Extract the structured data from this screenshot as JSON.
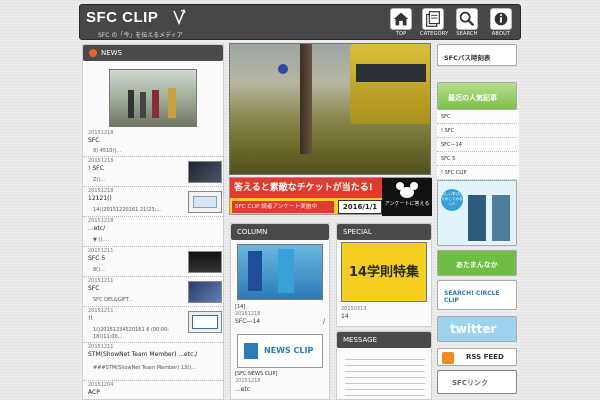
{
  "header": {
    "logo": "SFC CLIP",
    "tagline": "SFC の「今」を伝えるメディア",
    "nav": [
      {
        "label": "TOP",
        "icon": "home-icon"
      },
      {
        "label": "CATEGORY",
        "icon": "category-icon"
      },
      {
        "label": "SEARCH",
        "icon": "search-icon"
      },
      {
        "label": "ABOUT",
        "icon": "info-icon"
      }
    ]
  },
  "news": {
    "title": "NEWS",
    "items": [
      {
        "date": "20151218",
        "title": "SFC",
        "sub": "9) 4510()..."
      },
      {
        "date": "20151218",
        "title": "! SFC",
        "sub": "Z()..."
      },
      {
        "date": "20151218",
        "title": "12121()",
        "sub": "14()20151220161 21(23:..."
      },
      {
        "date": "20151218",
        "title": "...etc/",
        "sub": "▼ ()..."
      },
      {
        "date": "20151211",
        "title": "SFC 5",
        "sub": "8()..."
      },
      {
        "date": "20151211",
        "title": "SFC",
        "sub": "SFC DEL&GIFT..."
      },
      {
        "date": "20151211",
        "title": "!!",
        "sub": "1()20151234520161 6 (00:00-18()11:00..."
      },
      {
        "date": "20151211",
        "title": "STM(ShowNet Team Member) ...etc./",
        "sub": "###STM(ShowNet Team Member) 13()..."
      },
      {
        "date": "20151204",
        "title": "ACP",
        "sub": ""
      }
    ]
  },
  "feature": {
    "banner_main": "答えると素敵なチケットが当たる!",
    "banner_sub": "SFC CLIP 読者アンケート実施中",
    "banner_date": "2016/1/1",
    "banner_cta": "アンケートに答える"
  },
  "column": {
    "title": "COLUMN",
    "caption": "[14]",
    "date": "20151218",
    "text": "SFC—14",
    "slash": "/",
    "newsclip_label": "NEWS CLIP",
    "newsclip_caption": "[SFC NEWS CLIP]",
    "newsclip_date": "20151218",
    "newsclip_text": "...etc"
  },
  "special": {
    "title": "SPECIAL",
    "banner_text": "14学則特集",
    "date": "20150313",
    "text": "14"
  },
  "message": {
    "title": "MESSAGE"
  },
  "sidebar": {
    "links": [
      "SFC",
      "! SFC",
      "SFC—14",
      "SFC 5",
      "! SFC CLIP"
    ],
    "banner_schedule": "SFCバス時刻表",
    "banner_popular": "最近の人気記事",
    "banner_atamanaka": "あたまんなか",
    "banner_circle": "SEARCH! CIRCLE CLIP",
    "banner_twitter": "twitter",
    "banner_rss": "RSS FEED",
    "banner_sfclink": "SFCリンク",
    "ad_text": "新しい学び、ためしてみない?"
  },
  "colors": {
    "header_bg": "#474747",
    "accent": "#e8632e",
    "green": "#7cc04a",
    "yellow": "#f6d21a"
  }
}
